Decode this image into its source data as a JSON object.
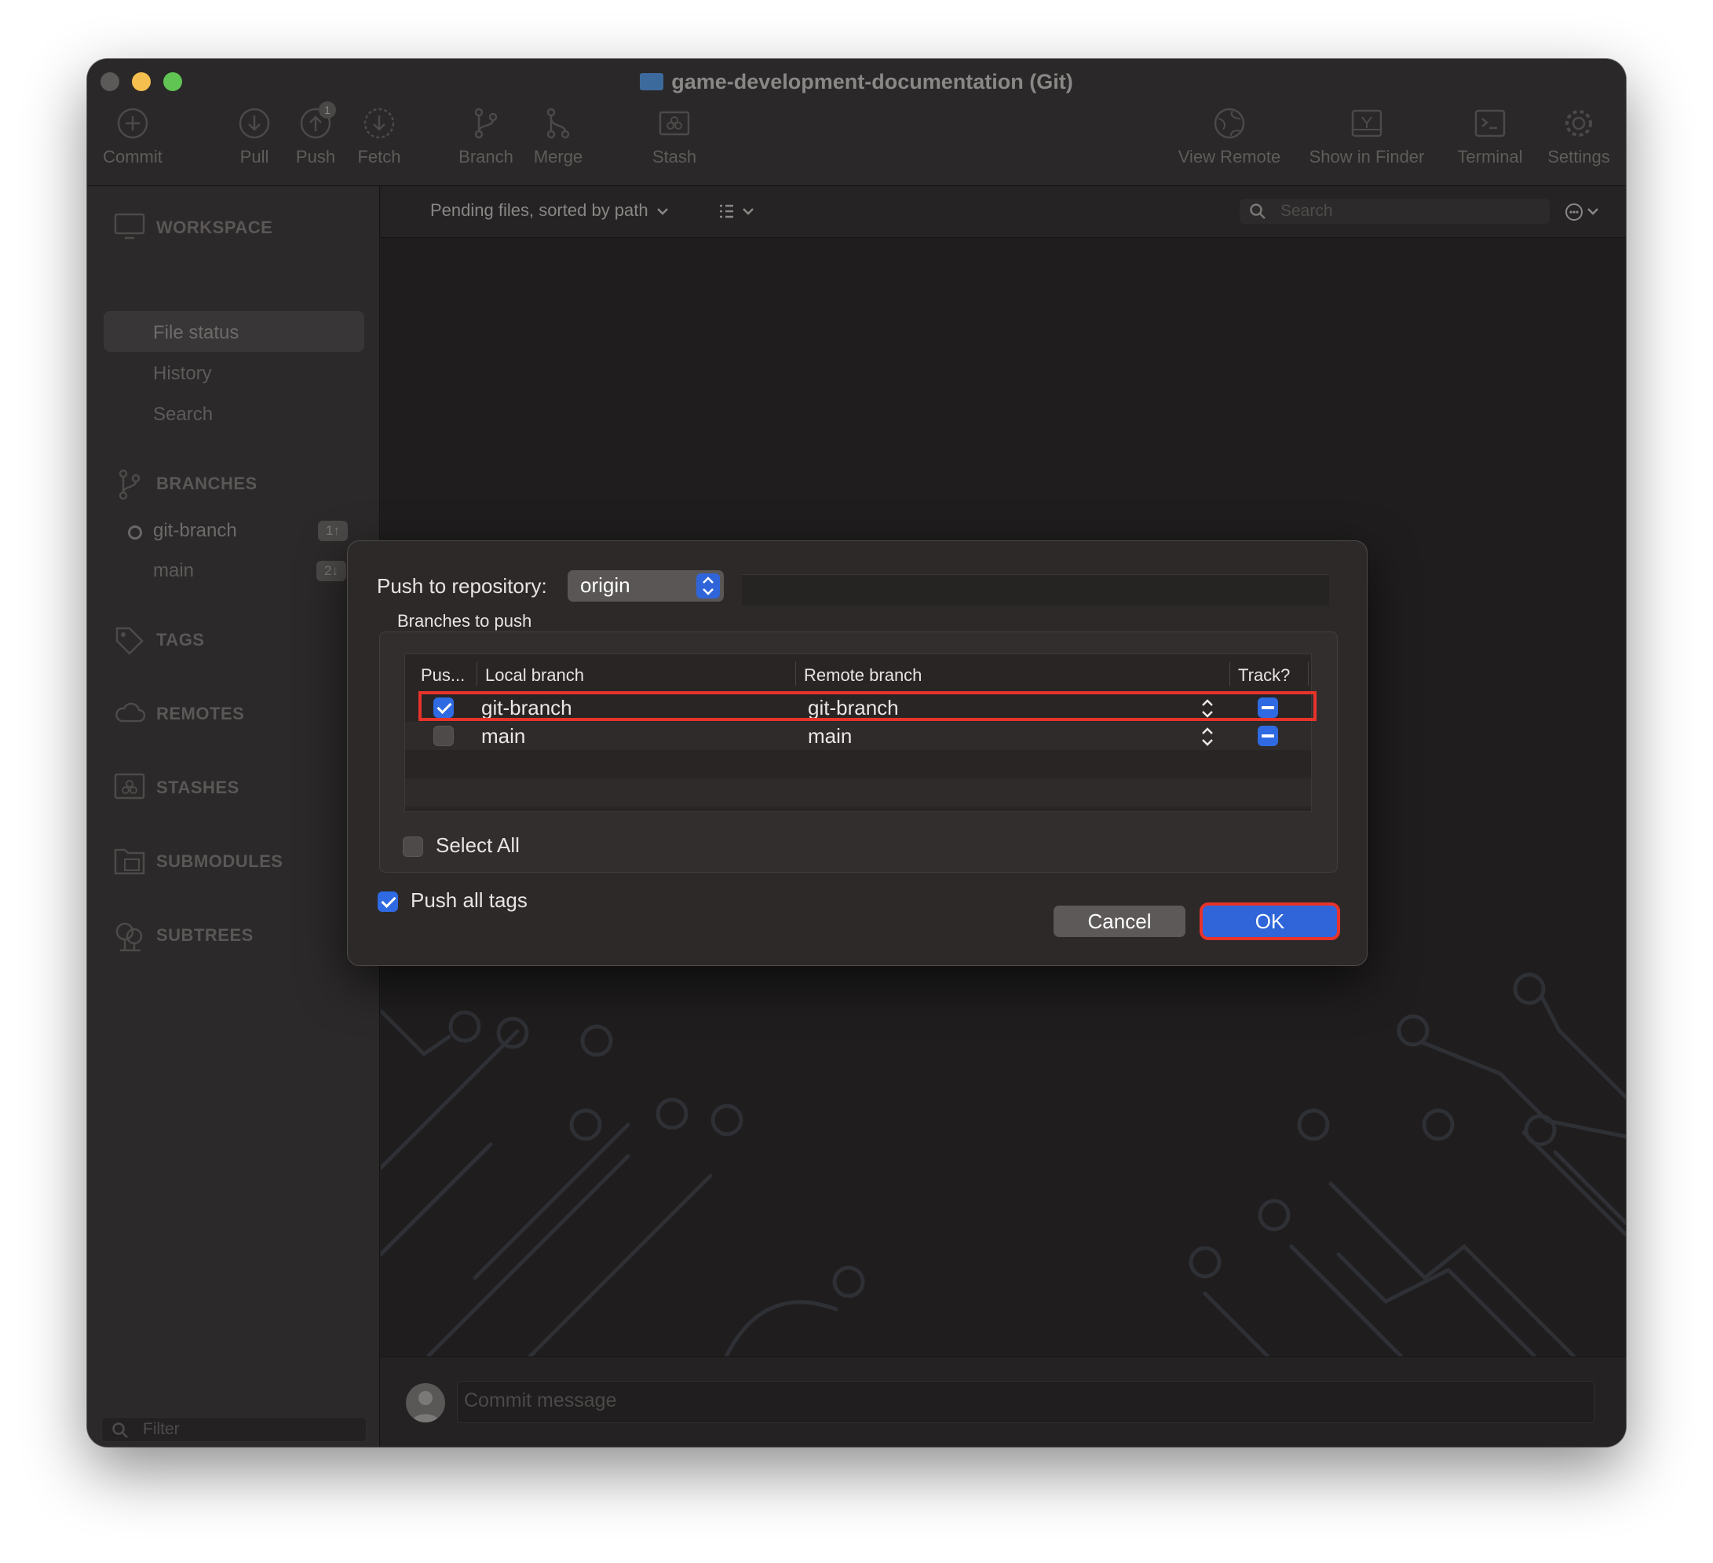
{
  "window": {
    "title": "game-development-documentation (Git)"
  },
  "toolbar": {
    "commit": "Commit",
    "pull": "Pull",
    "push": "Push",
    "push_badge": "1",
    "fetch": "Fetch",
    "branch": "Branch",
    "merge": "Merge",
    "stash": "Stash",
    "view_remote": "View Remote",
    "show_in_finder": "Show in Finder",
    "terminal": "Terminal",
    "settings": "Settings"
  },
  "sidebar": {
    "workspace": "WORKSPACE",
    "workspace_items": [
      "File status",
      "History",
      "Search"
    ],
    "branches": "BRANCHES",
    "branch_items": [
      {
        "name": "git-branch",
        "badge": "1↑"
      },
      {
        "name": "main",
        "badge": "2↓"
      }
    ],
    "tags": "TAGS",
    "remotes": "REMOTES",
    "stashes": "STASHES",
    "submodules": "SUBMODULES",
    "subtrees": "SUBTREES",
    "filter_placeholder": "Filter"
  },
  "main": {
    "sort_label": "Pending files, sorted by path",
    "search_placeholder": "Search",
    "commit_placeholder": "Commit message"
  },
  "dialog": {
    "push_to_label": "Push to repository:",
    "repository": "origin",
    "branches_label": "Branches to push",
    "columns": [
      "Pus...",
      "Local branch",
      "Remote branch",
      "Track?"
    ],
    "rows": [
      {
        "push": true,
        "local": "git-branch",
        "remote": "git-branch",
        "track": true
      },
      {
        "push": false,
        "local": "main",
        "remote": "main",
        "track": true
      }
    ],
    "select_all": "Select All",
    "push_all_tags": "Push all tags",
    "cancel": "Cancel",
    "ok": "OK"
  },
  "colors": {
    "accent": "#2f65d9",
    "highlight": "#e8332a"
  }
}
